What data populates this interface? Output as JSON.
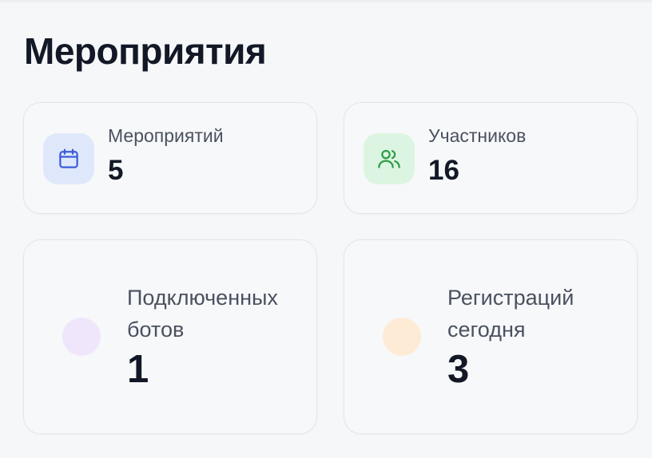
{
  "page": {
    "title": "Мероприятия"
  },
  "stats": [
    {
      "label": "Мероприятий",
      "value": "5",
      "icon": "calendar-icon",
      "accent": "#3b5bdb"
    },
    {
      "label": "Участников",
      "value": "16",
      "icon": "users-icon",
      "accent": "#2f9e44"
    },
    {
      "label": "Подключенных ботов",
      "value": "1",
      "icon": "purple-dot",
      "accent": "#efe6fc"
    },
    {
      "label": "Регистраций сегодня",
      "value": "3",
      "icon": "orange-dot",
      "accent": "#fdebd6"
    }
  ]
}
